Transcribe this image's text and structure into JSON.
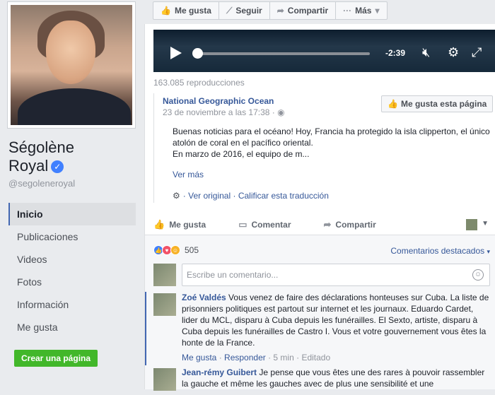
{
  "profile": {
    "name_line1": "Ségolène",
    "name_line2": "Royal",
    "handle": "@segoleneroyal"
  },
  "nav": [
    {
      "label": "Inicio",
      "active": true
    },
    {
      "label": "Publicaciones",
      "active": false
    },
    {
      "label": "Videos",
      "active": false
    },
    {
      "label": "Fotos",
      "active": false
    },
    {
      "label": "Información",
      "active": false
    },
    {
      "label": "Me gusta",
      "active": false
    }
  ],
  "create_page_label": "Crear una página",
  "top_actions": {
    "like": "Me gusta",
    "follow": "Seguir",
    "share": "Compartir",
    "more": "Más"
  },
  "video": {
    "time_remaining": "-2:39",
    "views": "163.085 reproducciones"
  },
  "shared_post": {
    "page_name": "National Geographic Ocean",
    "date": "23 de noviembre a las 17:38",
    "like_page_label": "Me gusta esta página",
    "text": "Buenas noticias para el océano! Hoy, Francia ha protegido la isla clipperton, el único atolón de coral en el pacífico oriental.",
    "text2": "En marzo de 2016, el equipo de m...",
    "see_more": "Ver más",
    "see_original": "Ver original",
    "rate_translation": "Calificar esta traducción"
  },
  "post_actions": {
    "like": "Me gusta",
    "comment": "Comentar",
    "share": "Compartir"
  },
  "reactions": {
    "count": "505",
    "sort_label": "Comentarios destacados"
  },
  "comment_input": {
    "placeholder": "Escribe un comentario..."
  },
  "comments": [
    {
      "author": "Zoé Valdés",
      "text": "Vous venez de faire des déclarations honteuses sur Cuba. La liste de prisonniers politiques est partout sur internet et les journaux. Eduardo Cardet, lider du MCL, disparu à Cuba depuis les funérailles. El Sexto, artiste, disparu à Cuba depuis les funérailles de Castro I. Vous et votre gouvernement vous êtes la honte de la France.",
      "like": "Me gusta",
      "reply": "Responder",
      "time": "5 min",
      "edited": "Editado"
    },
    {
      "author": "Jean-rémy Guibert",
      "text": "Je pense que vous êtes une des rares à pouvoir rassembler la gauche et même les gauches avec de plus une sensibilité et une"
    }
  ],
  "icons": {
    "verified": "verified-badge-icon",
    "play": "play-icon",
    "mute": "mute-icon",
    "settings": "gear-icon",
    "fullscreen": "fullscreen-icon"
  },
  "colors": {
    "link": "#365899",
    "accent": "#4267b2",
    "create_btn": "#42b72a"
  }
}
